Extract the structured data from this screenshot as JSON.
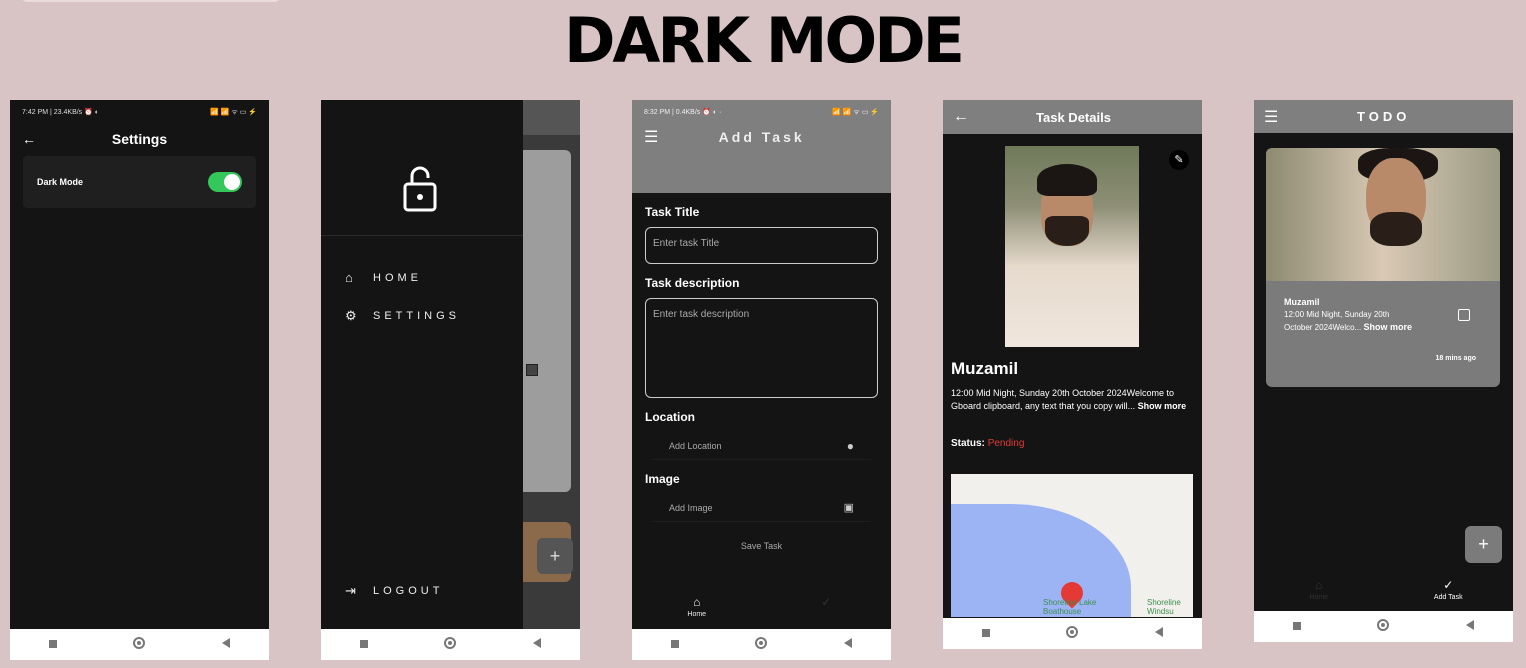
{
  "heading": "DARK MODE",
  "settings_screen": {
    "status_left": "7:42 PM | 23.4KB/s ⏰ ◐",
    "status_right": "📶 📶 ᯤ ▭ ⚡",
    "title": "Settings",
    "dark_mode_label": "Dark Mode",
    "dark_mode_on": true
  },
  "drawer_screen": {
    "items": [
      "HOME",
      "SETTINGS",
      "LOGOUT"
    ]
  },
  "add_task_screen": {
    "status_left": "8:32 PM | 0.4KB/s ⏰ ◐ ·",
    "status_right": "📶 📶 ᯤ ▭ ⚡",
    "title": "Add Task",
    "task_title_label": "Task Title",
    "task_title_placeholder": "Enter task Title",
    "desc_label": "Task description",
    "desc_placeholder": "Enter task description",
    "location_label": "Location",
    "location_placeholder": "Add Location",
    "image_label": "Image",
    "image_placeholder": "Add Image",
    "save_label": "Save Task",
    "nav_home": "Home"
  },
  "task_details_screen": {
    "title": "Task Details",
    "name": "Muzamil",
    "description": "12:00 Mid Night, Sunday 20th October 2024Welcome to Gboard clipboard, any text that you copy will...",
    "show_more": "Show more",
    "status_label": "Status:",
    "status_value": "Pending",
    "map_label_1": "Shoreline Lake Boathouse",
    "map_label_2": "Shoreline Windsu"
  },
  "todo_screen": {
    "title": "TODO",
    "task_name": "Muzamil",
    "task_desc_line1": "12:00 Mid Night, Sunday 20th",
    "task_desc_line2": "October 2024Welco...",
    "show_more": "Show more",
    "time_ago": "18 mins ago",
    "nav_home": "Home",
    "nav_add": "Add Task"
  }
}
